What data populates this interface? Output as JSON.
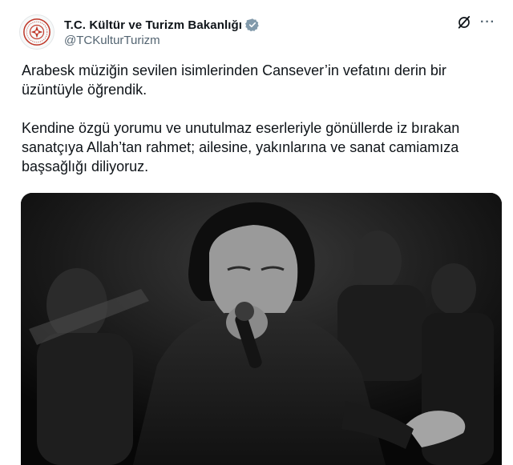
{
  "account": {
    "display_name": "T.C. Kültür ve Turizm Bakanlığı",
    "handle": "@TCKulturTurizm",
    "avatar_icon": "ministry-emblem-icon",
    "verified_icon": "verified-badge-icon",
    "verified_color": "#829aab"
  },
  "actions": {
    "grok_icon": "grok-icon",
    "more_icon": "more-options-icon",
    "more_glyph": "···"
  },
  "tweet": {
    "text": "Arabesk müziğin sevilen isimlerinden Cansever’in vefatını derin bir\nüzüntüyle öğrendik.\n\nKendine özgü yorumu ve unutulmaz eserleriyle gönüllerde iz bırakan\nsanatçıya Allah’tan rahmet; ailesine, yakınlarına ve sanat camiamıza\nbaşsağlığı diliyoruz."
  },
  "media": {
    "type": "photo",
    "style": "black-and-white"
  },
  "colors": {
    "text": "#0f1419",
    "secondary": "#536471",
    "emblem_red": "#c0392b"
  }
}
